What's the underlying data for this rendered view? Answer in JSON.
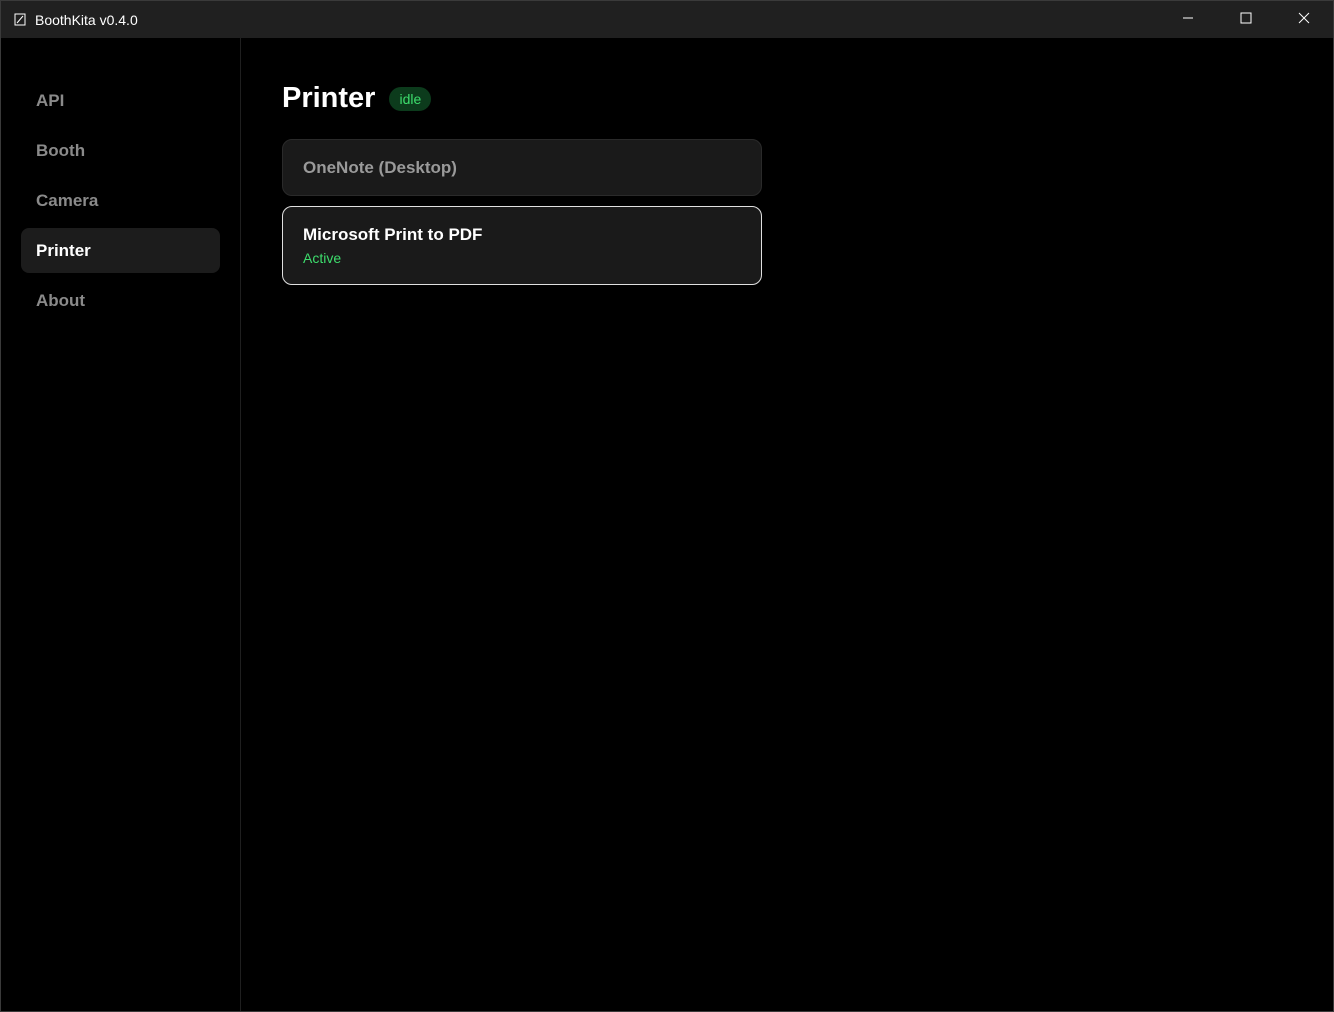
{
  "window": {
    "title": "BoothKita v0.4.0",
    "app_icon": "app-icon",
    "controls": [
      "minimize-icon",
      "maximize-icon",
      "close-icon"
    ]
  },
  "sidebar": {
    "items": [
      {
        "label": "API",
        "active": false
      },
      {
        "label": "Booth",
        "active": false
      },
      {
        "label": "Camera",
        "active": false
      },
      {
        "label": "Printer",
        "active": true
      },
      {
        "label": "About",
        "active": false
      }
    ]
  },
  "page": {
    "title": "Printer",
    "status_badge": "idle"
  },
  "printers": [
    {
      "name": "OneNote (Desktop)",
      "status": "",
      "selected": false
    },
    {
      "name": "Microsoft Print to PDF",
      "status": "Active",
      "selected": true
    }
  ],
  "colors": {
    "background": "#000000",
    "titlebar": "#202020",
    "accent_green": "#3ddc6c",
    "badge_bg": "#0c3b1c",
    "card_bg": "#1a1a1a",
    "nav_active_bg": "#1c1c1c",
    "muted_text": "#8a8a8a"
  }
}
